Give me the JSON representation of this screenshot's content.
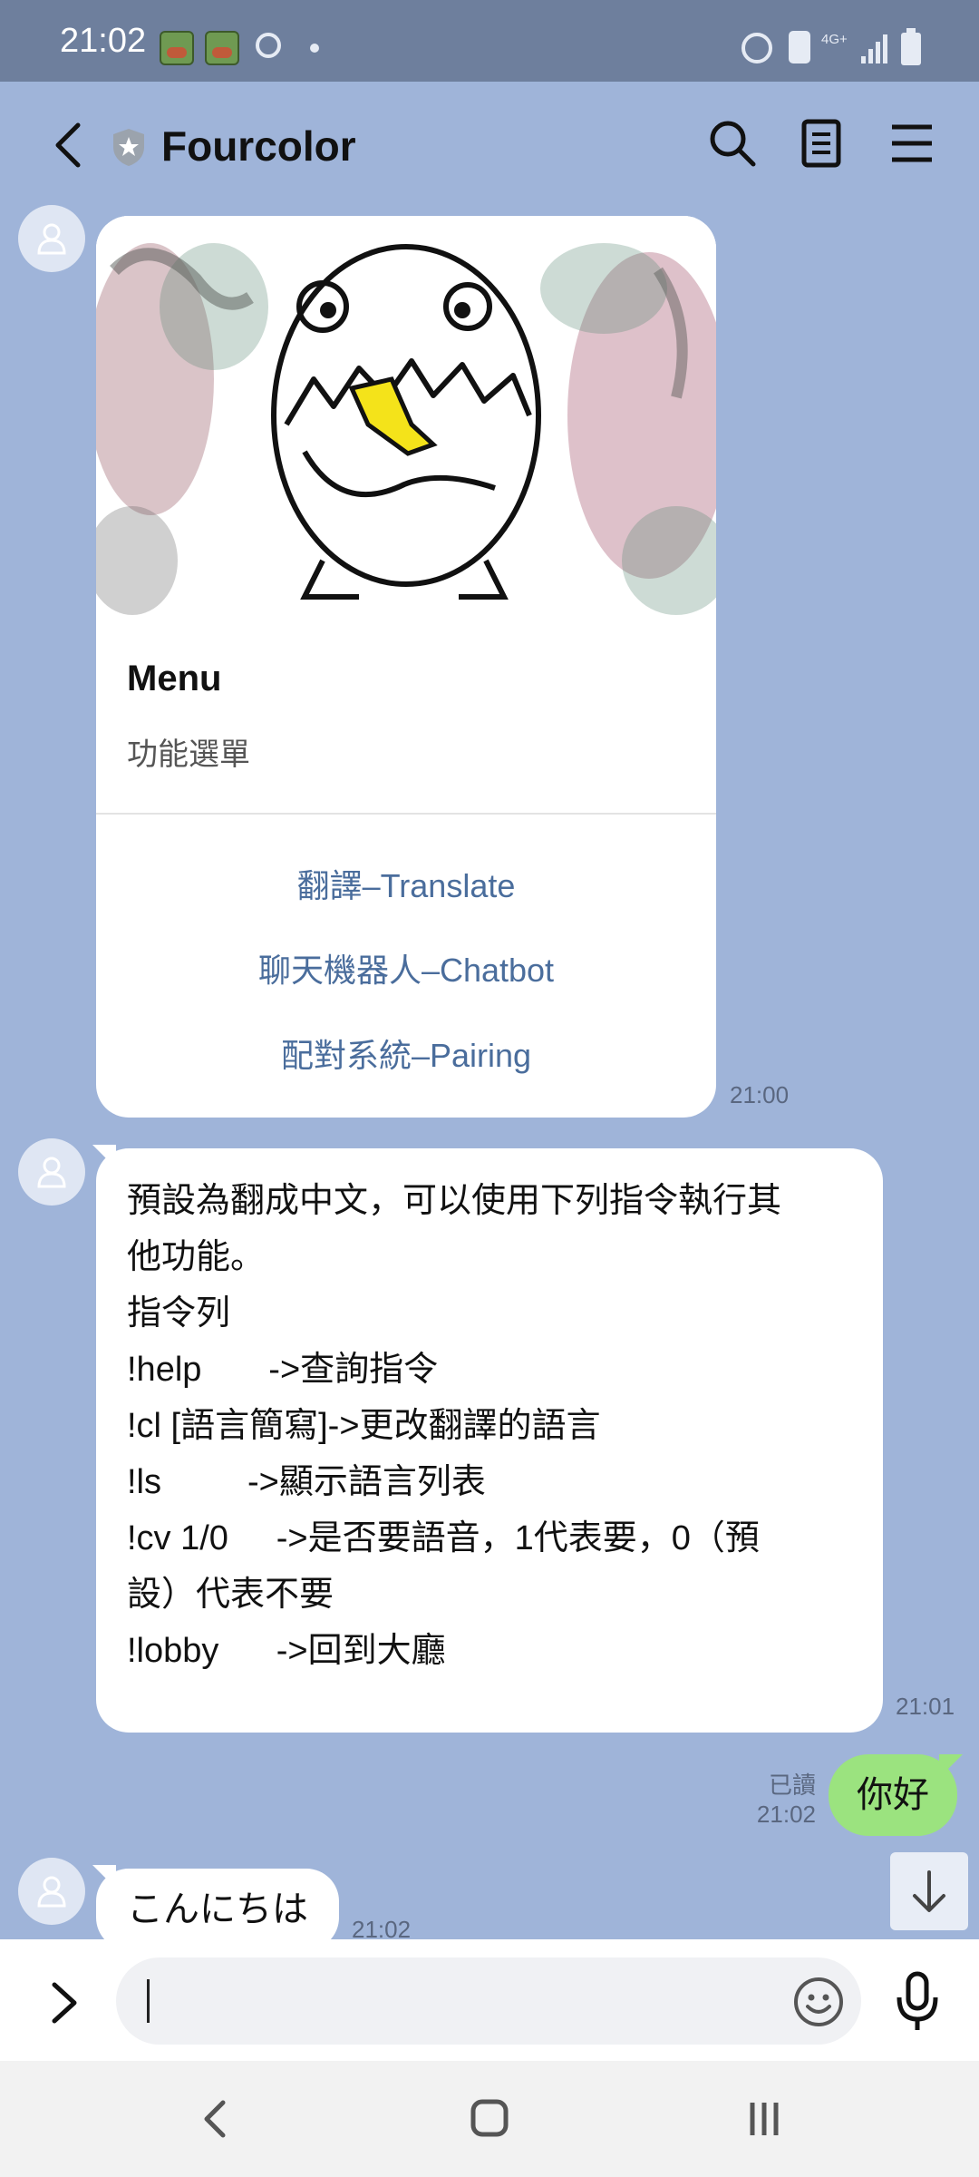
{
  "status_bar": {
    "time": "21:02",
    "network": "4G+"
  },
  "header": {
    "title": "Fourcolor"
  },
  "messages": {
    "card": {
      "title": "Menu",
      "subtitle": "功能選單",
      "buttons": [
        "翻譯–Translate",
        "聊天機器人–Chatbot",
        "配對系統–Pairing"
      ],
      "time": "21:00"
    },
    "help": {
      "lines": [
        "預設為翻成中文，可以使用下列指令執行其",
        "他功能。",
        "指令列",
        "!help       ->查詢指令",
        "!cl [語言簡寫]->更改翻譯的語言",
        "!ls         ->顯示語言列表",
        "!cv 1/0     ->是否要語音，1代表要，0（預",
        "設）代表不要",
        "!lobby      ->回到大廳"
      ],
      "time": "21:01"
    },
    "sent": {
      "text": "你好",
      "read_label": "已讀",
      "time": "21:02"
    },
    "reply": {
      "text": "こんにちは",
      "time": "21:02"
    }
  },
  "input": {
    "placeholder": ""
  },
  "colors": {
    "chat_bg": "#9fb4d9",
    "sent_bubble": "#9be37f",
    "link": "#4a6d9c"
  }
}
